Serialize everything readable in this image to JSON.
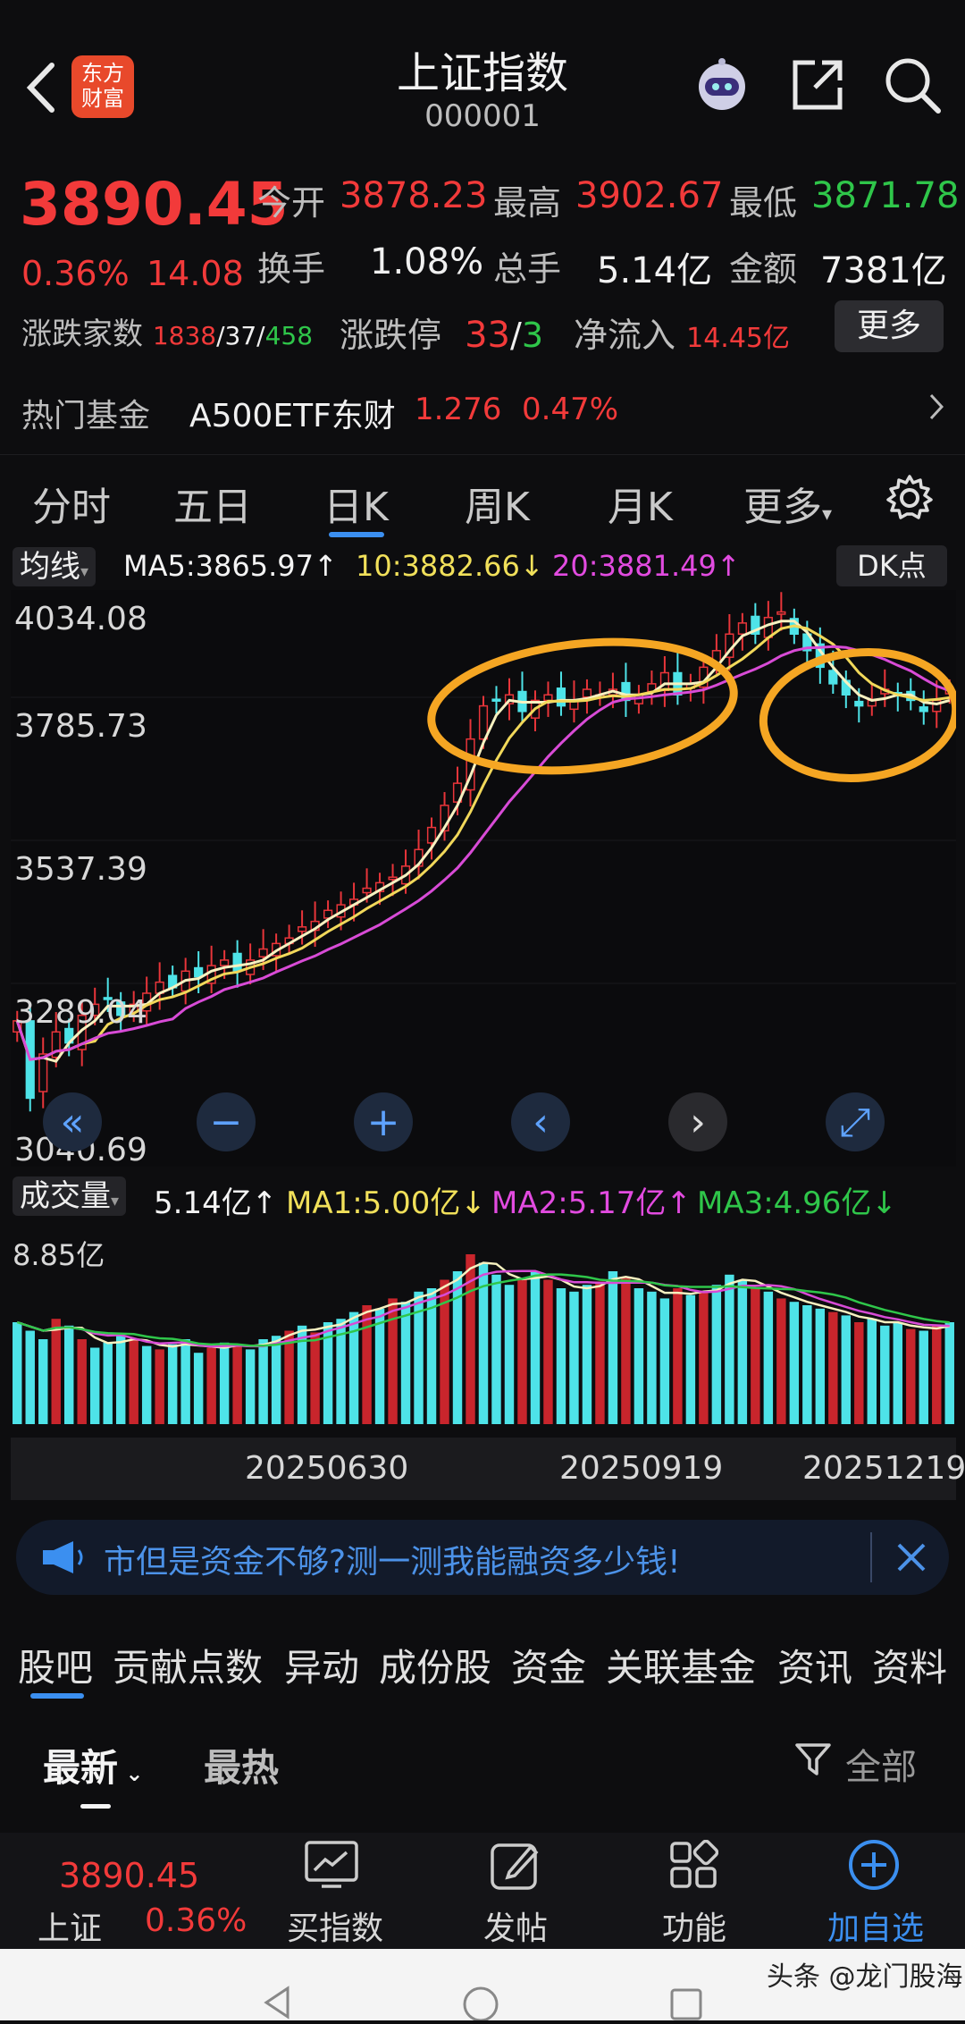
{
  "header": {
    "title": "上证指数",
    "code": "000001",
    "logo_text_1": "东方",
    "logo_text_2": "财富"
  },
  "quote": {
    "price": "3890.45",
    "change_pct": "0.36%",
    "change": "14.08",
    "open_label": "今开",
    "open": "3878.23",
    "high_label": "最高",
    "high": "3902.67",
    "low_label": "最低",
    "low": "3871.78",
    "turnover_label": "换手",
    "turnover": "1.08%",
    "volume_label": "总手",
    "volume": "5.14亿",
    "amount_label": "金额",
    "amount": "7381亿",
    "breadth_label": "涨跌家数",
    "breadth_up": "1838",
    "breadth_flat": "37",
    "breadth_down": "458",
    "limit_label": "涨跌停",
    "limit_up": "33",
    "limit_down": "3",
    "netflow_label": "净流入",
    "netflow": "14.45亿",
    "more_button": "更多",
    "fund_label": "热门基金",
    "fund_name": "A500ETF东财",
    "fund_price": "1.276",
    "fund_pct": "0.47%"
  },
  "kline_tabs": [
    "分时",
    "五日",
    "日K",
    "周K",
    "月K",
    "更多"
  ],
  "active_tab": "日K",
  "ma_bar": {
    "selector": "均线",
    "ma5": "MA5:3865.97↑",
    "ma10": "10:3882.66↓",
    "ma20": "20:3881.49↑",
    "dk_button": "DK点"
  },
  "chart_data": {
    "type": "candlestick",
    "y_ticks": [
      "4034.08",
      "3785.73",
      "3537.39",
      "3289.04",
      "3040.69"
    ],
    "ylim": [
      3040.69,
      4034.08
    ],
    "series": [
      {
        "name": "MA5",
        "color": "#f6f1c0"
      },
      {
        "name": "MA10",
        "color": "#f1d85a"
      },
      {
        "name": "MA20",
        "color": "#d84bd6"
      }
    ],
    "close_path": [
      3290,
      3150,
      3230,
      3270,
      3250,
      3300,
      3320,
      3330,
      3300,
      3320,
      3340,
      3360,
      3350,
      3380,
      3370,
      3390,
      3400,
      3380,
      3400,
      3420,
      3430,
      3440,
      3460,
      3470,
      3490,
      3500,
      3510,
      3530,
      3540,
      3550,
      3570,
      3600,
      3640,
      3680,
      3720,
      3800,
      3860,
      3870,
      3880,
      3850,
      3870,
      3880,
      3860,
      3870,
      3890,
      3880,
      3890,
      3870,
      3880,
      3900,
      3920,
      3880,
      3900,
      3930,
      3960,
      3990,
      4010,
      3990,
      4020,
      4030,
      3990,
      3960,
      3930,
      3900,
      3880,
      3860,
      3870,
      3890,
      3880,
      3870,
      3850,
      3870,
      3890
    ]
  },
  "nav_buttons": [
    "«",
    "−",
    "+",
    "‹",
    "›",
    "⤢"
  ],
  "volume": {
    "selector": "成交量",
    "vol": "5.14亿↑",
    "ma1": "MA1:5.00亿↓",
    "ma2": "MA2:5.17亿↑",
    "ma3": "MA3:4.96亿↓",
    "max_label": "8.85亿",
    "dates": [
      "20250630",
      "20250919",
      "20251219"
    ],
    "bars": [
      0.6,
      0.55,
      0.5,
      0.62,
      0.58,
      0.5,
      0.45,
      0.48,
      0.52,
      0.5,
      0.46,
      0.44,
      0.47,
      0.5,
      0.42,
      0.45,
      0.48,
      0.46,
      0.44,
      0.5,
      0.52,
      0.55,
      0.58,
      0.54,
      0.6,
      0.62,
      0.66,
      0.7,
      0.68,
      0.74,
      0.72,
      0.78,
      0.8,
      0.85,
      0.9,
      1.0,
      0.95,
      0.88,
      0.82,
      0.86,
      0.9,
      0.85,
      0.8,
      0.78,
      0.82,
      0.84,
      0.9,
      0.86,
      0.8,
      0.78,
      0.74,
      0.8,
      0.76,
      0.78,
      0.82,
      0.88,
      0.85,
      0.8,
      0.78,
      0.74,
      0.72,
      0.7,
      0.68,
      0.66,
      0.64,
      0.6,
      0.62,
      0.58,
      0.6,
      0.56,
      0.55,
      0.58,
      0.6
    ]
  },
  "banner": {
    "text": "市但是资金不够?测一测我能融资多少钱!"
  },
  "sub_tabs": [
    "股吧",
    "贡献点数",
    "异动",
    "成份股",
    "资金",
    "关联基金",
    "资讯",
    "资料"
  ],
  "feed": {
    "latest": "最新",
    "hot": "最热",
    "filter": "全部"
  },
  "bottom_bar": {
    "price": "3890.45",
    "name": "上证",
    "pct": "0.36%",
    "items": [
      "买指数",
      "发帖",
      "功能",
      "加自选"
    ]
  },
  "watermark": "头条 @龙门股海"
}
